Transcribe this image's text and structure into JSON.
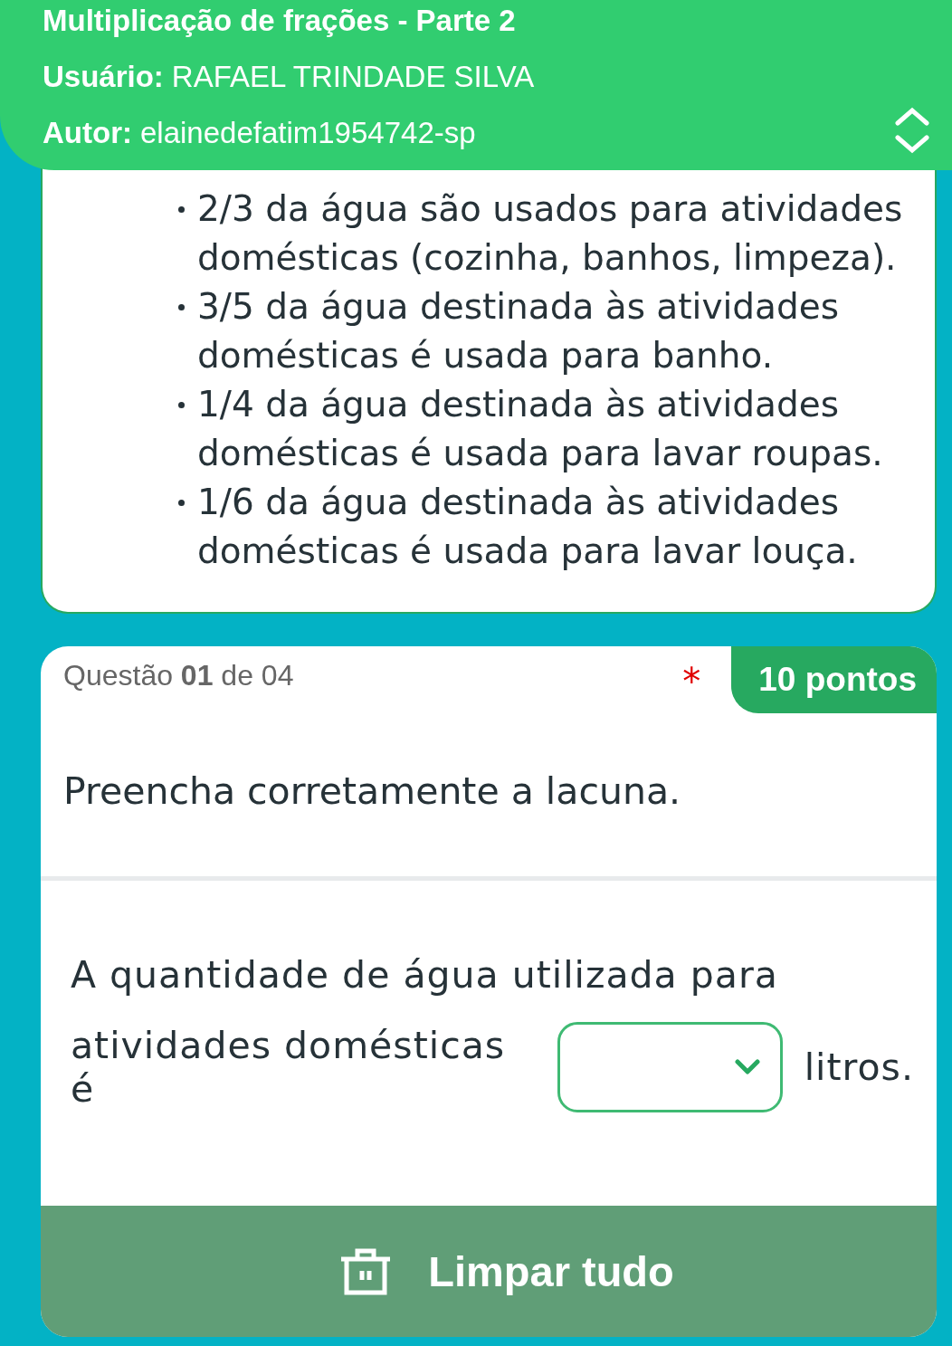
{
  "header": {
    "title": "Multiplicação de frações - Parte 2",
    "user_label": "Usuário:",
    "user": "RAFAEL TRINDADE SILVA",
    "author_label": "Autor:",
    "author": "elainedefatim1954742-sp",
    "expanded": false
  },
  "statement": {
    "bullets": [
      "2/3 da água são usados para atividades domésticas (cozinha, banhos, limpeza).",
      "3/5 da água destinada às atividades domésticas é usada para banho.",
      "1/4 da água destinada às atividades domésticas é usada para lavar roupas.",
      "1/6 da água destinada às atividades domésticas é usada para lavar louça."
    ]
  },
  "question": {
    "counter": "Questão **01** de 04",
    "required_mark": "*",
    "points": "10 pontos",
    "prompt": "Preencha corretamente a lacuna.",
    "sentence_line_1": "A quantidade de água utilizada para",
    "sentence_before_blank": "atividades domésticas é",
    "sentence_after_blank": "litros.",
    "clear_button": "Limpar tudo"
  }
}
